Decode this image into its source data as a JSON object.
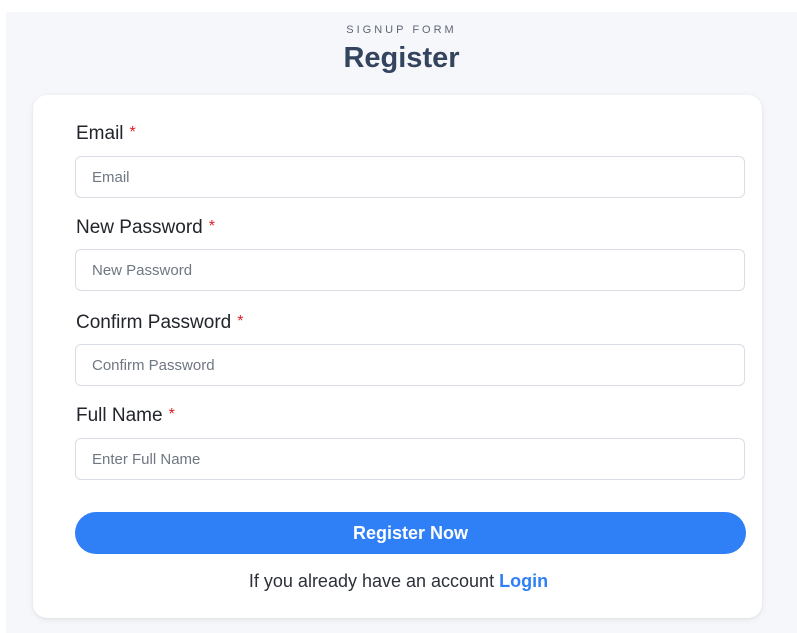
{
  "header": {
    "subtitle": "SIGNUP FORM",
    "title": "Register"
  },
  "form": {
    "required_marker": "*",
    "fields": [
      {
        "label": "Email",
        "placeholder": "Email",
        "value": ""
      },
      {
        "label": "New Password",
        "placeholder": "New Password",
        "value": ""
      },
      {
        "label": "Confirm Password",
        "placeholder": "Confirm Password",
        "value": ""
      },
      {
        "label": "Full Name",
        "placeholder": "Enter Full Name",
        "value": ""
      }
    ],
    "submit_label": "Register Now",
    "footer_text": "If you already have an account",
    "login_label": "Login"
  },
  "colors": {
    "accent": "#2f80f7",
    "required": "#e31b23",
    "title": "#34445f",
    "background": "#f6f7fa"
  }
}
